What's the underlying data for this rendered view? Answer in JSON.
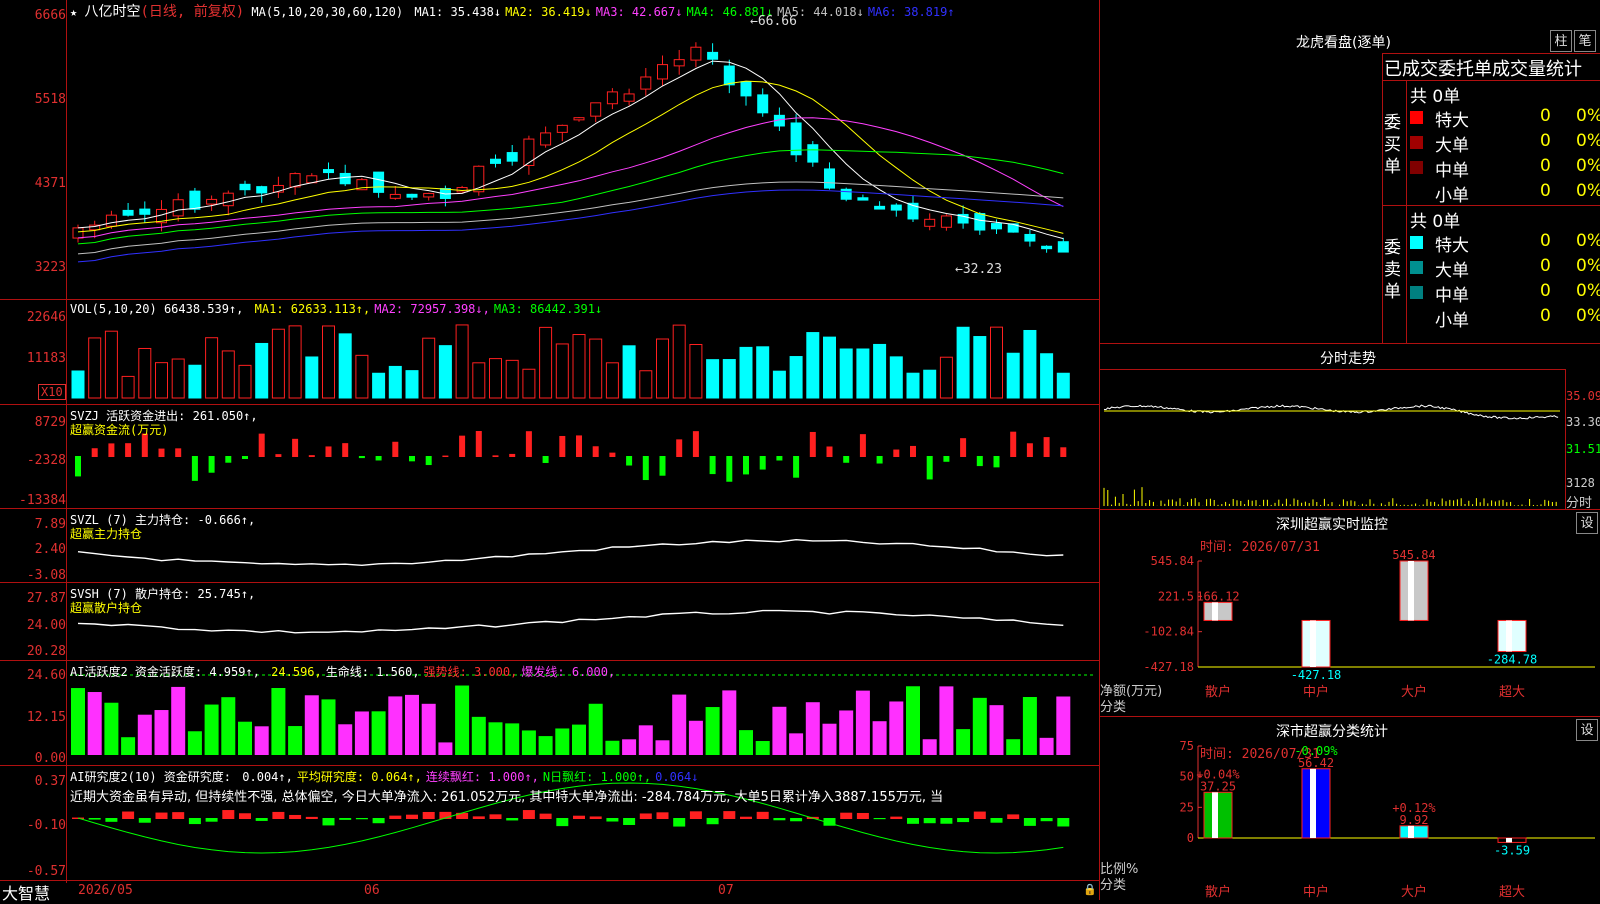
{
  "main": {
    "title": "八亿时空",
    "period": "(日线, 前复权)",
    "ma_label": "MA(5,10,20,30,60,120)",
    "ma": [
      {
        "name": "MA1:",
        "value": "35.438↓",
        "color": "#ffffff"
      },
      {
        "name": "MA2:",
        "value": "36.419↓",
        "color": "#ffff00"
      },
      {
        "name": "MA3:",
        "value": "42.667↓",
        "color": "#ff40ff"
      },
      {
        "name": "MA4:",
        "value": "46.881↓",
        "color": "#00ff00"
      },
      {
        "name": "MA5:",
        "value": "44.018↓",
        "color": "#c0c0c0"
      },
      {
        "name": "MA6:",
        "value": "38.819↑",
        "color": "#3030ff"
      }
    ],
    "y_ticks": [
      "6666",
      "5518",
      "4371",
      "3223"
    ],
    "hi_label": "66.66",
    "lo_label": "←32.23"
  },
  "vol": {
    "label": "VOL(5,10,20)",
    "value": "66438.539↑,",
    "ma": [
      {
        "name": "MA1:",
        "value": "62633.113↑,",
        "color": "#ffff00"
      },
      {
        "name": "MA2:",
        "value": "72957.398↓,",
        "color": "#ff40ff"
      },
      {
        "name": "MA3:",
        "value": "86442.391↓",
        "color": "#00ff00"
      }
    ],
    "y_ticks": [
      "22646",
      "11183"
    ],
    "unit": "X10"
  },
  "svzj": {
    "label": "SVZJ  活跃资金进出:",
    "value": "261.050↑,",
    "sub": "超赢资金流(万元)",
    "y_ticks": [
      "8729",
      "-2328",
      "-13384"
    ]
  },
  "svzl": {
    "label": "SVZL (7) 主力持仓:",
    "value": "-0.666↑,",
    "sub": "超赢主力持仓",
    "y_ticks": [
      "7.89",
      "2.40",
      "-3.08"
    ]
  },
  "svsh": {
    "label": "SVSH (7) 散户持仓:",
    "value": "25.745↑,",
    "sub": "超赢散户持仓",
    "y_ticks": [
      "27.87",
      "24.00",
      "20.28"
    ]
  },
  "ai1": {
    "label": "AI活跃度2 资金活跃度:",
    "value": "4.959↑,",
    "items": [
      {
        "text": "24.596,",
        "color": "#ffff00"
      },
      {
        "text": "生命线: 1.560,",
        "color": "#ffffff"
      },
      {
        "text": "强势线: 3.000,",
        "color": "#ff3030"
      },
      {
        "text": "爆发线: 6.000,",
        "color": "#ff40ff"
      }
    ],
    "y_ticks": [
      "24.60",
      "12.15",
      "0.00"
    ]
  },
  "ai2": {
    "label": "AI研究度2(10) 资金研究度:",
    "items": [
      {
        "text": "0.004↑,",
        "color": "#ffffff"
      },
      {
        "text": "平均研究度: 0.064↑,",
        "color": "#ffff00"
      },
      {
        "text": "连续飘红: 1.000↑,",
        "color": "#ff40ff"
      },
      {
        "text": "N日飘红: 1.000↑,",
        "color": "#00ff00"
      },
      {
        "text": "0.064↓",
        "color": "#3030ff"
      }
    ],
    "comment": "近期大资金虽有异动, 但持续性不强, 总体偏空, 今日大单净流入: 261.052万元, 其中特大单净流出: -284.784万元, 大单5日累计净入3887.155万元, 当",
    "y_ticks": [
      "0.37",
      "-0.10",
      "-0.57"
    ]
  },
  "xaxis": {
    "labels": [
      "2026/05",
      "06",
      "07"
    ]
  },
  "brand": "大智慧",
  "side": {
    "lhb_title": "龙虎看盘(逐单)",
    "btn_col": "柱",
    "btn_stroke": "笔",
    "stat_title": "已成交委托单成交量统计",
    "buy": {
      "side_label": "委买单",
      "total": "共 0单",
      "rows": [
        {
          "name": "特大",
          "num": "0",
          "pct": "0%",
          "color": "#ff0000"
        },
        {
          "name": "大单",
          "num": "0",
          "pct": "0%",
          "color": "#a00000"
        },
        {
          "name": "中单",
          "num": "0",
          "pct": "0%",
          "color": "#800000"
        },
        {
          "name": "小单",
          "num": "0",
          "pct": "0%",
          "color": ""
        }
      ]
    },
    "sell": {
      "side_label": "委卖单",
      "total": "共 0单",
      "rows": [
        {
          "name": "特大",
          "num": "0",
          "pct": "0%",
          "color": "#00ffff"
        },
        {
          "name": "大单",
          "num": "0",
          "pct": "0%",
          "color": "#009090"
        },
        {
          "name": "中单",
          "num": "0",
          "pct": "0%",
          "color": "#008080"
        },
        {
          "name": "小单",
          "num": "0",
          "pct": "0%",
          "color": ""
        }
      ]
    },
    "intraday": {
      "title": "分时走势",
      "price_ticks": [
        "35.09",
        "33.30",
        "31.51"
      ],
      "vol_tick": "3128",
      "unit": "分时"
    },
    "monitor": {
      "title": "深圳超赢实时监控",
      "btn": "设",
      "time": "时间: 2026/07/31",
      "unit_label": "净额(万元)",
      "cat_label": "分类",
      "y_ticks": [
        "545.84",
        "221.5",
        "-102.84",
        "-427.18"
      ]
    },
    "classify": {
      "title": "深市超赢分类统计",
      "btn": "设",
      "time": "时间: 2026/07/31",
      "unit_label": "比例%",
      "cat_label": "分类",
      "y_ticks": [
        "75",
        "50",
        "25",
        "0"
      ]
    }
  },
  "chart_data": [
    {
      "type": "bar",
      "title": "深圳超赢实时监控",
      "ylabel": "净额(万元)",
      "categories": [
        "散户",
        "中户",
        "大户",
        "超大"
      ],
      "values": [
        166.12,
        -427.18,
        545.84,
        -284.78
      ],
      "ylim": [
        -427.18,
        545.84
      ]
    },
    {
      "type": "bar",
      "title": "深市超赢分类统计",
      "ylabel": "比例%",
      "categories": [
        "散户",
        "中户",
        "大户",
        "超大"
      ],
      "values": [
        37.25,
        56.42,
        9.92,
        -3.59
      ],
      "changes": [
        "+0.04%",
        "-0.09%",
        "+0.12%",
        ""
      ],
      "ylim": [
        0,
        75
      ]
    }
  ]
}
